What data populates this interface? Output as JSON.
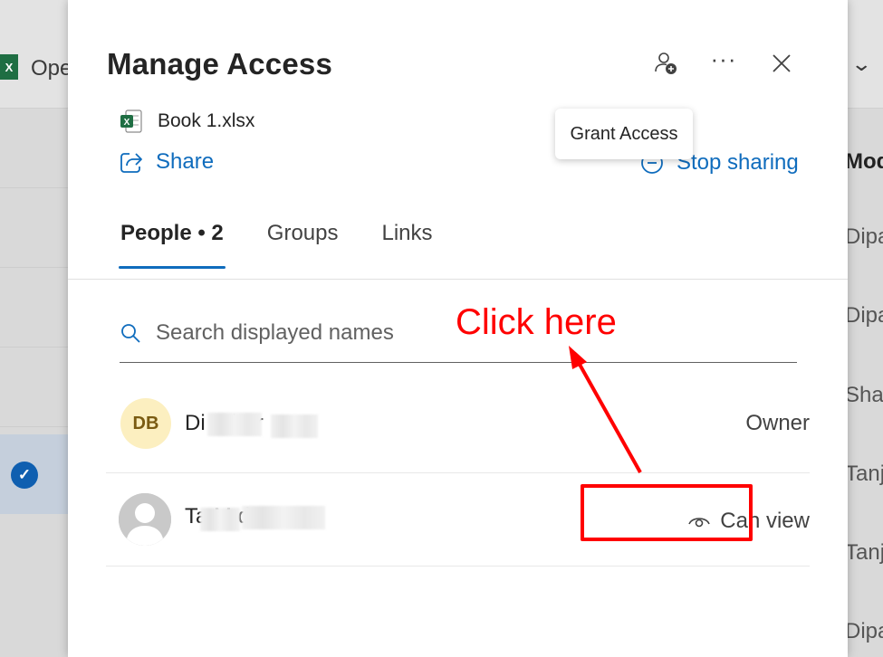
{
  "background": {
    "toolbar_open_label": "Ope",
    "excel_badge": "X",
    "right_column_header": "Mod",
    "right_column_cells": [
      "Dipa",
      "Dipa",
      "Shar",
      "Tanjo",
      "Tanjo",
      "Dipa"
    ]
  },
  "dialog": {
    "title": "Manage Access",
    "tooltip": "Grant Access",
    "more_label": "···",
    "file": {
      "name": "Book 1.xlsx"
    },
    "share_label": "Share",
    "stop_sharing_label": "Stop sharing",
    "tabs": [
      {
        "label": "People • 2",
        "active": true
      },
      {
        "label": "Groups",
        "active": false
      },
      {
        "label": "Links",
        "active": false
      }
    ],
    "search": {
      "placeholder": "Search displayed names",
      "value": ""
    },
    "people": [
      {
        "initials": "DB",
        "name_visible": "Di       B    har",
        "role": "Owner"
      },
      {
        "initials": "",
        "name_visible": "Ta          M      d",
        "role": "Can view"
      }
    ]
  },
  "annotation": {
    "text": "Click here",
    "color": "#ff0000"
  },
  "colors": {
    "accent": "#0f6cbd",
    "excel_green": "#1f6e43",
    "avatar_bg": "#fcefc0"
  },
  "icons": [
    "excel-icon",
    "check-circle-icon",
    "chevron-down-icon",
    "person-add-icon",
    "more-icon",
    "close-icon",
    "excel-file-icon",
    "share-icon",
    "stop-circle-icon",
    "search-icon",
    "eye-icon",
    "avatar-placeholder-icon"
  ]
}
